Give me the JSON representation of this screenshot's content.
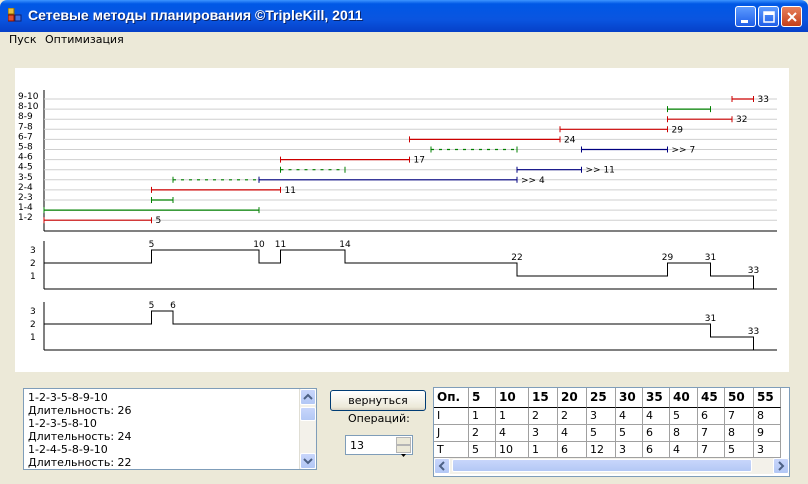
{
  "window": {
    "title": "Сетевые методы планирования ©TripleKill, 2011",
    "controls": [
      "minimize",
      "maximize",
      "close"
    ]
  },
  "menu": {
    "items": [
      "Пуск",
      "Оптимизация"
    ]
  },
  "colors": {
    "critical": "#cc0000",
    "reserve": "#008000",
    "other": "#000080",
    "titlebar": "#0a55e0"
  },
  "gantt": {
    "rows": [
      "9-10",
      "8-10",
      "8-9",
      "7-8",
      "6-7",
      "5-8",
      "4-6",
      "4-5",
      "3-5",
      "2-4",
      "2-3",
      "1-4",
      "1-2"
    ],
    "labels": [
      {
        "row": "9-10",
        "text": "33"
      },
      {
        "row": "8-9",
        "text": "32"
      },
      {
        "row": "7-8",
        "text": "29"
      },
      {
        "row": "6-7",
        "text": "24"
      },
      {
        "row": "5-8",
        "text": ">> 7"
      },
      {
        "row": "4-6",
        "text": "17"
      },
      {
        "row": "4-5",
        "text": ">> 11"
      },
      {
        "row": "3-5",
        "text": ">> 4"
      },
      {
        "row": "2-4",
        "text": "11"
      },
      {
        "row": "1-2",
        "text": "5"
      }
    ]
  },
  "resource_chart_1": {
    "y_ticks": [
      "3",
      "2",
      "1"
    ],
    "labels": [
      "5",
      "10",
      "11",
      "14",
      "22",
      "29",
      "31",
      "33"
    ]
  },
  "resource_chart_2": {
    "y_ticks": [
      "3",
      "2",
      "1"
    ],
    "labels": [
      "5",
      "6",
      "31",
      "33"
    ]
  },
  "paths_list": {
    "items": [
      "1-2-3-5-8-9-10",
      "Длительность: 26",
      "1-2-3-5-8-10",
      "Длительность: 24",
      "1-2-4-5-8-9-10",
      "Длительность: 22"
    ]
  },
  "back_button": {
    "label": "вернуться"
  },
  "operations": {
    "label": "Операций:",
    "value": "13"
  },
  "table": {
    "headers": [
      "Оп.",
      "5",
      "10",
      "15",
      "20",
      "25",
      "30",
      "35",
      "40",
      "45",
      "50",
      "55"
    ],
    "rows": [
      [
        "I",
        "1",
        "1",
        "2",
        "2",
        "3",
        "4",
        "4",
        "5",
        "6",
        "7",
        "8"
      ],
      [
        "J",
        "2",
        "4",
        "3",
        "4",
        "5",
        "5",
        "6",
        "8",
        "7",
        "8",
        "9"
      ],
      [
        "T",
        "5",
        "10",
        "1",
        "6",
        "12",
        "3",
        "6",
        "4",
        "7",
        "5",
        "3"
      ]
    ]
  }
}
